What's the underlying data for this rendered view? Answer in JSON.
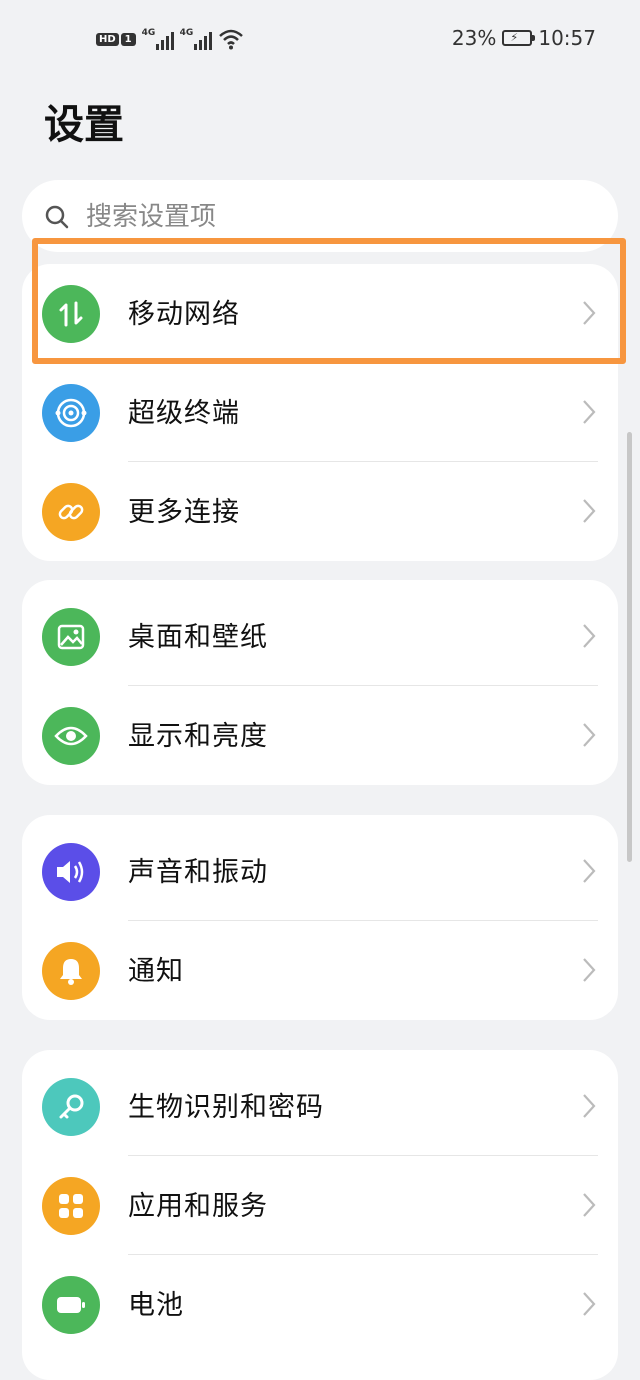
{
  "status_bar": {
    "hd_label": "HD",
    "sim_label": "1",
    "network_1": "4G",
    "network_2": "4G",
    "battery_percent": "23%",
    "time": "10:57"
  },
  "page_title": "设置",
  "search": {
    "placeholder": "搜索设置项"
  },
  "colors": {
    "highlight": "#f7963f",
    "green": "#4cb75a",
    "blue": "#3a9ee6",
    "orange": "#f5a623",
    "purple": "#5b4ee8",
    "teal": "#4dc8bc"
  },
  "groups": [
    {
      "items": [
        {
          "label": "移动网络",
          "icon": "mobile-network-icon",
          "color": "#4cb75a"
        },
        {
          "label": "超级终端",
          "icon": "super-device-icon",
          "color": "#3a9ee6"
        },
        {
          "label": "更多连接",
          "icon": "link-icon",
          "color": "#f5a623"
        }
      ]
    },
    {
      "items": [
        {
          "label": "桌面和壁纸",
          "icon": "wallpaper-icon",
          "color": "#4cb75a"
        },
        {
          "label": "显示和亮度",
          "icon": "eye-icon",
          "color": "#4cb75a"
        }
      ]
    },
    {
      "items": [
        {
          "label": "声音和振动",
          "icon": "speaker-icon",
          "color": "#5b4ee8"
        },
        {
          "label": "通知",
          "icon": "bell-icon",
          "color": "#f5a623"
        }
      ]
    },
    {
      "items": [
        {
          "label": "生物识别和密码",
          "icon": "key-icon",
          "color": "#4dc8bc"
        },
        {
          "label": "应用和服务",
          "icon": "apps-icon",
          "color": "#f5a623"
        },
        {
          "label": "电池",
          "icon": "battery-icon",
          "color": "#4cb75a"
        }
      ]
    }
  ]
}
